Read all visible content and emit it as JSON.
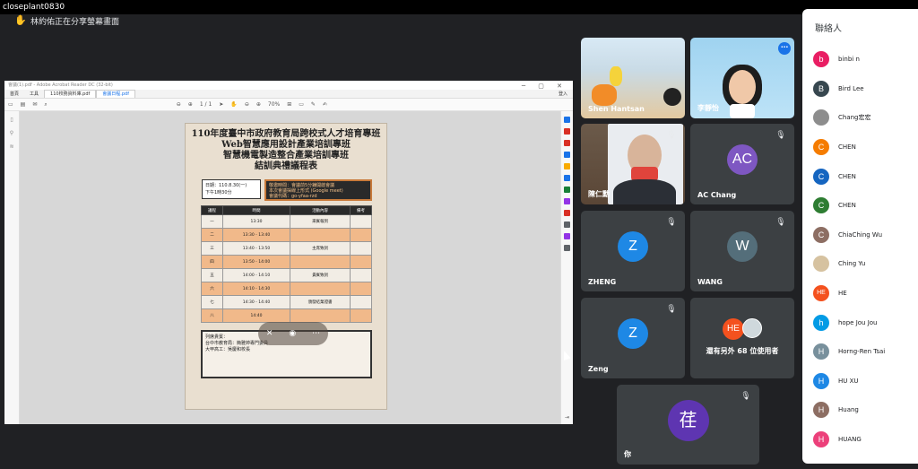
{
  "window_title": "closeplant0830",
  "share_banner": {
    "text": "林約佑正在分享螢幕畫面"
  },
  "presentation": {
    "app_title": "會議(1).pdf - Adobe Acrobat Reader DC (32-bit)",
    "menu": [
      "首頁",
      "工具"
    ],
    "tabs": [
      "110校務資料庫.pdf",
      "會議日程.pdf"
    ],
    "login_label": "登入",
    "page_indicator": "1 / 1",
    "zoom_value": "70%",
    "document": {
      "title_lines": [
        "110年度臺中市政府教育局跨校式人才培育專班",
        "Web智慧應用設計產業培訓專班",
        "智慧機電製造整合產業培訓專班",
        "結訓典禮議程表"
      ],
      "date_text": "日期：110.8.30(一)",
      "time_text": "下午1時30分",
      "notice_lines": [
        "敬邀時間：會議前5分鐘開啟會議",
        "本次會議採線上形式 (Google meet)",
        "會議代碼：go-yfaa-rzd"
      ],
      "table_headers": [
        "議程",
        "時間",
        "活動內容",
        "備考"
      ],
      "rows": [
        {
          "no": "一",
          "time": "13:30",
          "content": "來賓報到",
          "note": ""
        },
        {
          "no": "二",
          "time": "13:30 - 13:40",
          "content": "",
          "note": ""
        },
        {
          "no": "三",
          "time": "13:40 - 13:50",
          "content": "主席致詞",
          "note": ""
        },
        {
          "no": "四",
          "time": "13:50 - 14:00",
          "content": "",
          "note": ""
        },
        {
          "no": "五",
          "time": "14:00 - 14:10",
          "content": "貴賓致詞",
          "note": ""
        },
        {
          "no": "六",
          "time": "14:10 - 14:30",
          "content": "",
          "note": ""
        },
        {
          "no": "七",
          "time": "14:30 - 14:40",
          "content": "頒發結業證書",
          "note": ""
        },
        {
          "no": "八",
          "time": "14:40",
          "content": "",
          "note": ""
        }
      ],
      "bottom_lines": [
        "列席貴賓：",
        "台中市教育局：簡雅婷專門委員",
        "大甲高工：吳慶和校長"
      ]
    }
  },
  "tiles": [
    {
      "name": "Shen Hantsan",
      "kind": "video"
    },
    {
      "name": "李靜怡",
      "kind": "video"
    },
    {
      "name": "陳仁勳",
      "kind": "video"
    },
    {
      "name": "AC Chang",
      "initials": "AC",
      "color": "#7e57c2"
    },
    {
      "name": "ZHENG",
      "initials": "Z",
      "color": "#1e88e5"
    },
    {
      "name": "WANG",
      "initials": "W",
      "color": "#546e7a"
    },
    {
      "name": "Zeng",
      "initials": "Z",
      "color": "#1e88e5"
    },
    {
      "name": "還有另外 68 位使用者",
      "initials": "HE",
      "color": "#f4511e"
    },
    {
      "name": "你",
      "initials": "荏",
      "color": "#5e35b1"
    }
  ],
  "contacts": {
    "header": "聯絡人",
    "items": [
      {
        "name": "binbi n",
        "initial": "b",
        "color": "#e91e63"
      },
      {
        "name": "Bird Lee",
        "initial": "B",
        "color": "#37474f"
      },
      {
        "name": "Chang宏宏",
        "initial": "",
        "color": "#8d8d8d"
      },
      {
        "name": "CHEN",
        "initial": "C",
        "color": "#f57c00"
      },
      {
        "name": "CHEN",
        "initial": "C",
        "color": "#1565c0"
      },
      {
        "name": "CHEN",
        "initial": "C",
        "color": "#2e7d32"
      },
      {
        "name": "ChiaChing Wu",
        "initial": "C",
        "color": "#8d6e63"
      },
      {
        "name": "Ching Yu",
        "initial": "",
        "color": "#d6c2a0"
      },
      {
        "name": "HE",
        "initial": "HE",
        "color": "#f4511e"
      },
      {
        "name": "hope Jou Jou",
        "initial": "h",
        "color": "#039be5"
      },
      {
        "name": "Horng-Ren Tsai",
        "initial": "H",
        "color": "#78909c"
      },
      {
        "name": "HU XU",
        "initial": "H",
        "color": "#1e88e5"
      },
      {
        "name": "Huang",
        "initial": "H",
        "color": "#8d6e63"
      },
      {
        "name": "HUANG",
        "initial": "H",
        "color": "#ec407a"
      }
    ]
  }
}
